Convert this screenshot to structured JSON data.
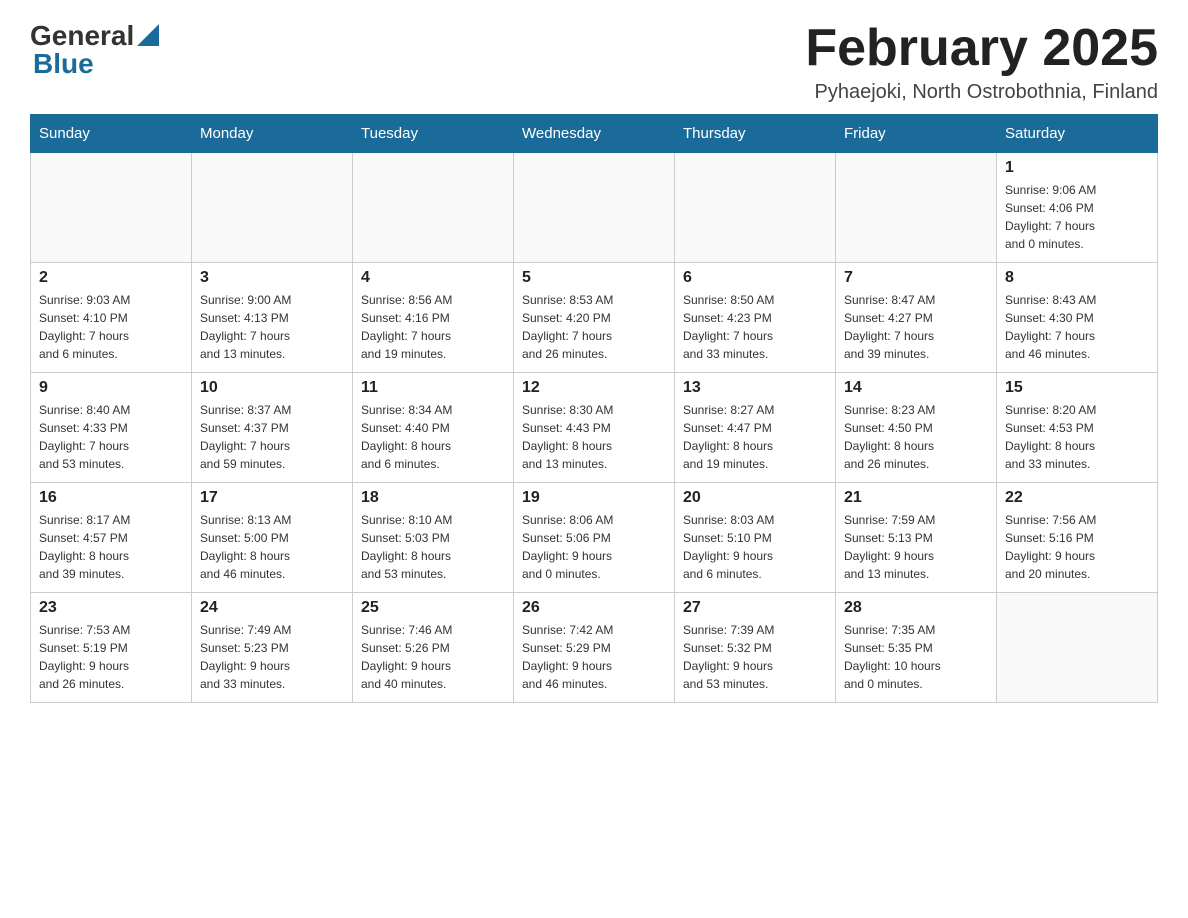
{
  "header": {
    "logo_general": "General",
    "logo_blue": "Blue",
    "month_title": "February 2025",
    "location": "Pyhaejoki, North Ostrobothnia, Finland"
  },
  "weekdays": [
    "Sunday",
    "Monday",
    "Tuesday",
    "Wednesday",
    "Thursday",
    "Friday",
    "Saturday"
  ],
  "weeks": [
    [
      {
        "day": "",
        "info": ""
      },
      {
        "day": "",
        "info": ""
      },
      {
        "day": "",
        "info": ""
      },
      {
        "day": "",
        "info": ""
      },
      {
        "day": "",
        "info": ""
      },
      {
        "day": "",
        "info": ""
      },
      {
        "day": "1",
        "info": "Sunrise: 9:06 AM\nSunset: 4:06 PM\nDaylight: 7 hours\nand 0 minutes."
      }
    ],
    [
      {
        "day": "2",
        "info": "Sunrise: 9:03 AM\nSunset: 4:10 PM\nDaylight: 7 hours\nand 6 minutes."
      },
      {
        "day": "3",
        "info": "Sunrise: 9:00 AM\nSunset: 4:13 PM\nDaylight: 7 hours\nand 13 minutes."
      },
      {
        "day": "4",
        "info": "Sunrise: 8:56 AM\nSunset: 4:16 PM\nDaylight: 7 hours\nand 19 minutes."
      },
      {
        "day": "5",
        "info": "Sunrise: 8:53 AM\nSunset: 4:20 PM\nDaylight: 7 hours\nand 26 minutes."
      },
      {
        "day": "6",
        "info": "Sunrise: 8:50 AM\nSunset: 4:23 PM\nDaylight: 7 hours\nand 33 minutes."
      },
      {
        "day": "7",
        "info": "Sunrise: 8:47 AM\nSunset: 4:27 PM\nDaylight: 7 hours\nand 39 minutes."
      },
      {
        "day": "8",
        "info": "Sunrise: 8:43 AM\nSunset: 4:30 PM\nDaylight: 7 hours\nand 46 minutes."
      }
    ],
    [
      {
        "day": "9",
        "info": "Sunrise: 8:40 AM\nSunset: 4:33 PM\nDaylight: 7 hours\nand 53 minutes."
      },
      {
        "day": "10",
        "info": "Sunrise: 8:37 AM\nSunset: 4:37 PM\nDaylight: 7 hours\nand 59 minutes."
      },
      {
        "day": "11",
        "info": "Sunrise: 8:34 AM\nSunset: 4:40 PM\nDaylight: 8 hours\nand 6 minutes."
      },
      {
        "day": "12",
        "info": "Sunrise: 8:30 AM\nSunset: 4:43 PM\nDaylight: 8 hours\nand 13 minutes."
      },
      {
        "day": "13",
        "info": "Sunrise: 8:27 AM\nSunset: 4:47 PM\nDaylight: 8 hours\nand 19 minutes."
      },
      {
        "day": "14",
        "info": "Sunrise: 8:23 AM\nSunset: 4:50 PM\nDaylight: 8 hours\nand 26 minutes."
      },
      {
        "day": "15",
        "info": "Sunrise: 8:20 AM\nSunset: 4:53 PM\nDaylight: 8 hours\nand 33 minutes."
      }
    ],
    [
      {
        "day": "16",
        "info": "Sunrise: 8:17 AM\nSunset: 4:57 PM\nDaylight: 8 hours\nand 39 minutes."
      },
      {
        "day": "17",
        "info": "Sunrise: 8:13 AM\nSunset: 5:00 PM\nDaylight: 8 hours\nand 46 minutes."
      },
      {
        "day": "18",
        "info": "Sunrise: 8:10 AM\nSunset: 5:03 PM\nDaylight: 8 hours\nand 53 minutes."
      },
      {
        "day": "19",
        "info": "Sunrise: 8:06 AM\nSunset: 5:06 PM\nDaylight: 9 hours\nand 0 minutes."
      },
      {
        "day": "20",
        "info": "Sunrise: 8:03 AM\nSunset: 5:10 PM\nDaylight: 9 hours\nand 6 minutes."
      },
      {
        "day": "21",
        "info": "Sunrise: 7:59 AM\nSunset: 5:13 PM\nDaylight: 9 hours\nand 13 minutes."
      },
      {
        "day": "22",
        "info": "Sunrise: 7:56 AM\nSunset: 5:16 PM\nDaylight: 9 hours\nand 20 minutes."
      }
    ],
    [
      {
        "day": "23",
        "info": "Sunrise: 7:53 AM\nSunset: 5:19 PM\nDaylight: 9 hours\nand 26 minutes."
      },
      {
        "day": "24",
        "info": "Sunrise: 7:49 AM\nSunset: 5:23 PM\nDaylight: 9 hours\nand 33 minutes."
      },
      {
        "day": "25",
        "info": "Sunrise: 7:46 AM\nSunset: 5:26 PM\nDaylight: 9 hours\nand 40 minutes."
      },
      {
        "day": "26",
        "info": "Sunrise: 7:42 AM\nSunset: 5:29 PM\nDaylight: 9 hours\nand 46 minutes."
      },
      {
        "day": "27",
        "info": "Sunrise: 7:39 AM\nSunset: 5:32 PM\nDaylight: 9 hours\nand 53 minutes."
      },
      {
        "day": "28",
        "info": "Sunrise: 7:35 AM\nSunset: 5:35 PM\nDaylight: 10 hours\nand 0 minutes."
      },
      {
        "day": "",
        "info": ""
      }
    ]
  ],
  "colors": {
    "header_bg": "#1a6b9a",
    "header_text": "#ffffff",
    "border": "#cccccc"
  }
}
